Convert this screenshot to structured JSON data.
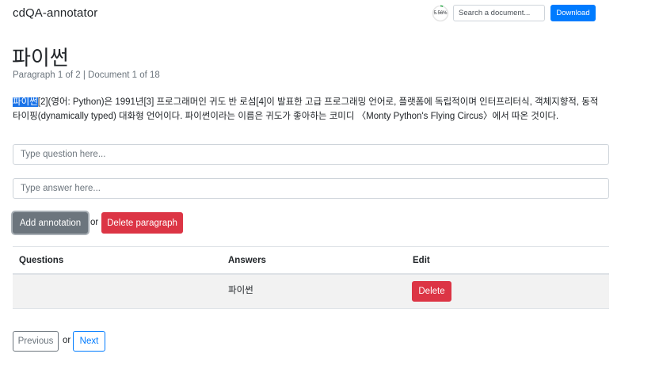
{
  "app": {
    "brand": "cdQA-annotator"
  },
  "toolbar": {
    "progress_label": "5.56%",
    "progress_fraction": 0.0556,
    "search_placeholder": "Search a document...",
    "download_label": "Download"
  },
  "document": {
    "title": "파이썬",
    "subtitle": "Paragraph 1 of 2 | Document 1 of 18",
    "highlighted_text": "파이썬",
    "paragraph_rest": "[2](영어: Python)은 1991년[3] 프로그래머인 귀도 반 로섬[4]이 발표한 고급 프로그래밍 언어로, 플랫폼에 독립적이며 인터프리터식, 객체지향적, 동적 타이핑(dynamically typed) 대화형 언어이다. 파이썬이라는 이름은 귀도가 좋아하는 코미디 〈Monty Python's Flying Circus〉에서 따온 것이다."
  },
  "form": {
    "question_placeholder": "Type question here...",
    "answer_placeholder": "Type answer here...",
    "add_label": "Add annotation",
    "or_label": "or",
    "delete_paragraph_label": "Delete paragraph"
  },
  "table": {
    "headers": {
      "questions": "Questions",
      "answers": "Answers",
      "edit": "Edit"
    },
    "rows": [
      {
        "question": "",
        "answer": "파이썬",
        "action_label": "Delete"
      }
    ]
  },
  "pager": {
    "previous_label": "Previous",
    "or_label": "or",
    "next_label": "Next"
  },
  "colors": {
    "primary": "#007bff",
    "danger": "#dc3545",
    "secondary": "#6c757d",
    "highlight": "#1a73e8"
  }
}
